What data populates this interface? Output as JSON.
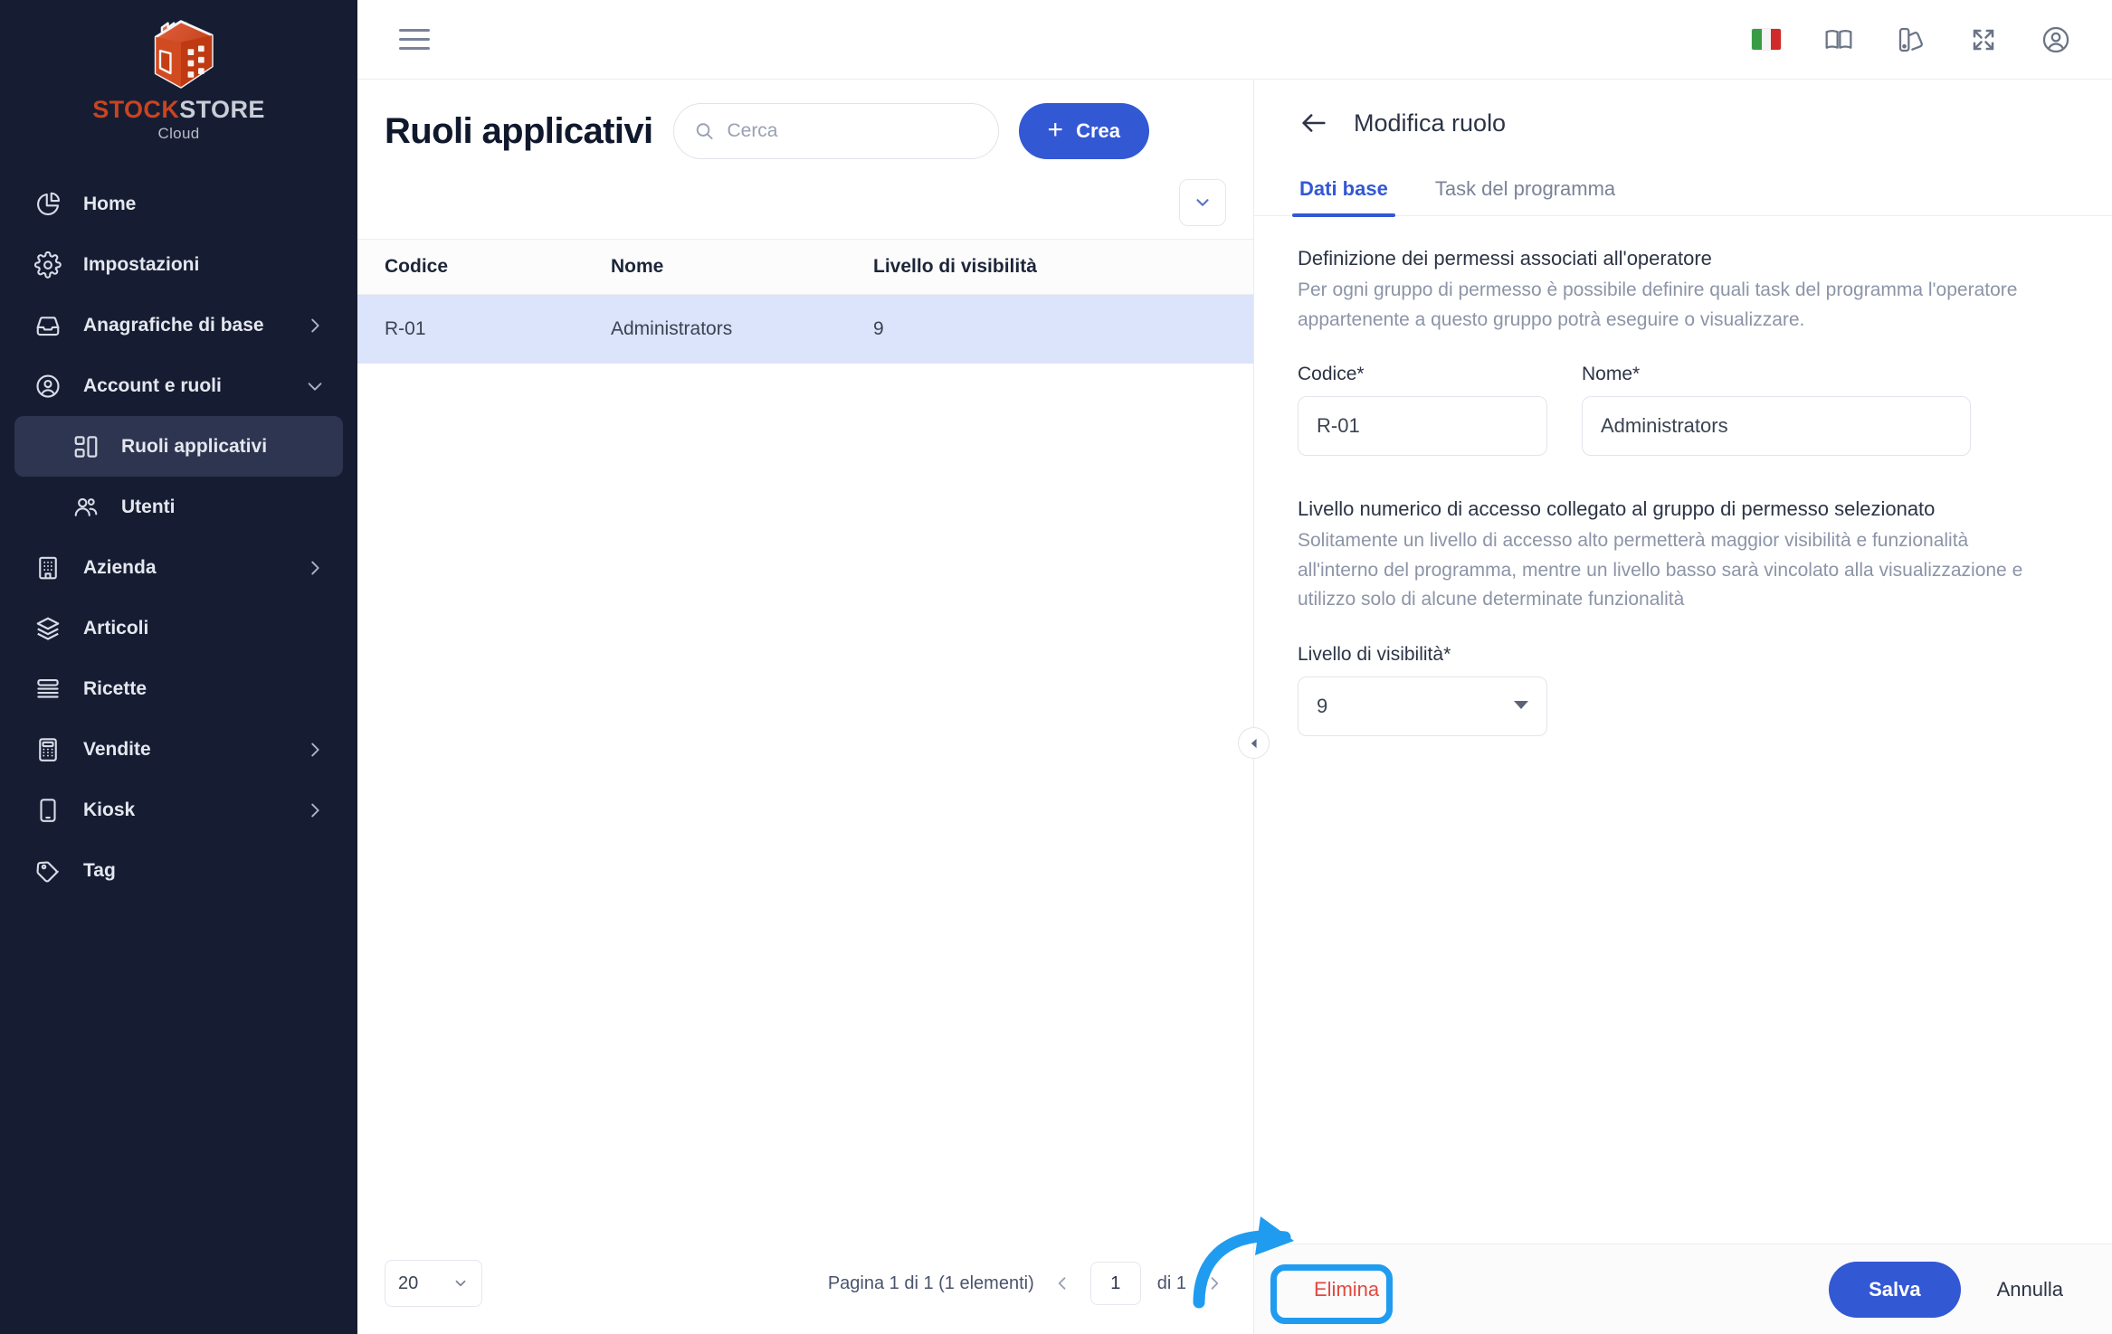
{
  "brand": {
    "logo_icon": "warehouse-box-icon",
    "name_part1": "STOCK",
    "name_part2": "STORE",
    "subtitle": "Cloud",
    "color_primary": "#c9441f",
    "color_sidebar": "#161d33",
    "color_accent": "#3358d4",
    "color_annotation": "#1f9cf0",
    "color_danger": "#e2483f"
  },
  "sidebar": {
    "items": [
      {
        "label": "Home",
        "icon": "pie-chart-icon",
        "has_chevron": false,
        "chevron": "",
        "active": false,
        "sub": false
      },
      {
        "label": "Impostazioni",
        "icon": "gear-icon",
        "has_chevron": false,
        "chevron": "",
        "active": false,
        "sub": false
      },
      {
        "label": "Anagrafiche di base",
        "icon": "inbox-icon",
        "has_chevron": true,
        "chevron": "right",
        "active": false,
        "sub": false
      },
      {
        "label": "Account e ruoli",
        "icon": "user-circle-icon",
        "has_chevron": true,
        "chevron": "down",
        "active": false,
        "sub": false
      },
      {
        "label": "Ruoli applicativi",
        "icon": "roles-grid-icon",
        "has_chevron": false,
        "chevron": "",
        "active": true,
        "sub": true
      },
      {
        "label": "Utenti",
        "icon": "users-icon",
        "has_chevron": false,
        "chevron": "",
        "active": false,
        "sub": true
      },
      {
        "label": "Azienda",
        "icon": "building-icon",
        "has_chevron": true,
        "chevron": "right",
        "active": false,
        "sub": false
      },
      {
        "label": "Articoli",
        "icon": "layers-icon",
        "has_chevron": false,
        "chevron": "",
        "active": false,
        "sub": false
      },
      {
        "label": "Ricette",
        "icon": "list-lines-icon",
        "has_chevron": false,
        "chevron": "",
        "active": false,
        "sub": false
      },
      {
        "label": "Vendite",
        "icon": "calculator-icon",
        "has_chevron": true,
        "chevron": "right",
        "active": false,
        "sub": false
      },
      {
        "label": "Kiosk",
        "icon": "tablet-icon",
        "has_chevron": true,
        "chevron": "right",
        "active": false,
        "sub": false
      },
      {
        "label": "Tag",
        "icon": "tag-icon",
        "has_chevron": false,
        "chevron": "",
        "active": false,
        "sub": false
      }
    ]
  },
  "topbar": {
    "menu_icon": "hamburger-menu-icon",
    "icons": [
      {
        "name": "language-flag-italy-icon"
      },
      {
        "name": "manual-book-icon"
      },
      {
        "name": "theme-palette-icon"
      },
      {
        "name": "fullscreen-expand-icon"
      },
      {
        "name": "user-account-icon"
      }
    ]
  },
  "list": {
    "title": "Ruoli applicativi",
    "search": {
      "placeholder": "Cerca",
      "value": "",
      "icon": "search-icon"
    },
    "create_button": {
      "label": "Crea",
      "icon": "plus-icon"
    },
    "filter_toggle_icon": "chevron-down-icon",
    "columns": [
      "Codice",
      "Nome",
      "Livello di visibilità"
    ],
    "rows": [
      {
        "codice": "R-01",
        "nome": "Administrators",
        "livello": "9",
        "selected": true
      }
    ],
    "footer": {
      "page_size": "20",
      "page_size_icon": "chevron-down-icon",
      "info": "Pagina 1 di 1 (1 elementi)",
      "prev_icon": "chevron-left-icon",
      "next_icon": "chevron-right-icon",
      "page_value": "1",
      "of_label": "di 1"
    }
  },
  "divider": {
    "collapse_icon": "triangle-left-icon"
  },
  "detail": {
    "back_icon": "arrow-left-icon",
    "title": "Modifica ruolo",
    "tabs": [
      {
        "label": "Dati base",
        "active": true
      },
      {
        "label": "Task del programma",
        "active": false
      }
    ],
    "section1": {
      "title": "Definizione dei permessi associati all'operatore",
      "description": "Per ogni gruppo di permesso è possibile definire quali task del programma l'operatore appartenente a questo gruppo potrà eseguire o visualizzare."
    },
    "fields": {
      "codice_label": "Codice",
      "codice_required": "*",
      "codice_value": "R-01",
      "nome_label": "Nome",
      "nome_required": "*",
      "nome_value": "Administrators"
    },
    "section2": {
      "title": "Livello numerico di accesso collegato al gruppo di permesso selezionato",
      "description": "Solitamente un livello di accesso alto permetterà maggior visibilità e funzionalità all'interno del programma, mentre un livello basso sarà vincolato alla visualizzazione e utilizzo solo di alcune determinate funzionalità"
    },
    "visibility": {
      "label": "Livello di visibilità",
      "required": "*",
      "value": "9",
      "caret_icon": "caret-down-icon"
    },
    "footer": {
      "delete_label": "Elimina",
      "save_label": "Salva",
      "cancel_label": "Annulla"
    }
  },
  "annotation": {
    "target": "Elimina",
    "shape": "rounded-rectangle-with-curved-arrow",
    "color": "#1f9cf0"
  }
}
